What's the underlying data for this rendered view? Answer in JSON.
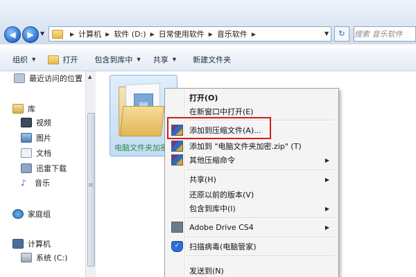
{
  "address_bar": {
    "crumbs": [
      "计算机",
      "软件 (D:)",
      "日常使用软件",
      "音乐软件"
    ],
    "search_placeholder": "搜索 音乐软件"
  },
  "toolbar": {
    "organize": "组织",
    "open": "打开",
    "include_in_library": "包含到库中",
    "share": "共享",
    "new_folder": "新建文件夹"
  },
  "sidebar": {
    "recent": "最近访问的位置",
    "library_header": "库",
    "videos": "视频",
    "pictures": "图片",
    "documents": "文档",
    "xunlei": "迅雷下载",
    "music": "音乐",
    "homegroup": "家庭组",
    "computer": "计算机",
    "system_c": "系统 (C:)"
  },
  "content": {
    "folder_label": "电脑文件夹加密"
  },
  "context_menu": {
    "items": [
      {
        "label": "打开(O)",
        "bold": true
      },
      {
        "label": "在新窗口中打开(E)"
      },
      {
        "label": "添加到压缩文件(A)..."
      },
      {
        "label": "添加到 \"电脑文件夹加密.zip\" (T)"
      },
      {
        "label": "其他压缩命令"
      },
      {
        "label": "共享(H)"
      },
      {
        "label": "还原以前的版本(V)"
      },
      {
        "label": "包含到库中(I)"
      },
      {
        "label": "Adobe Drive CS4"
      },
      {
        "label": "扫描病毒(电脑管家)"
      },
      {
        "label": "发送到(N)"
      }
    ]
  },
  "icons": {
    "back": "back-arrow-icon",
    "forward": "forward-arrow-icon",
    "refresh": "refresh-icon",
    "search": "search-icon"
  },
  "colors": {
    "highlight_box": "#cc1f1f",
    "selection_tile": "#c4dcf5",
    "folder_label": "#2f8a4a"
  }
}
